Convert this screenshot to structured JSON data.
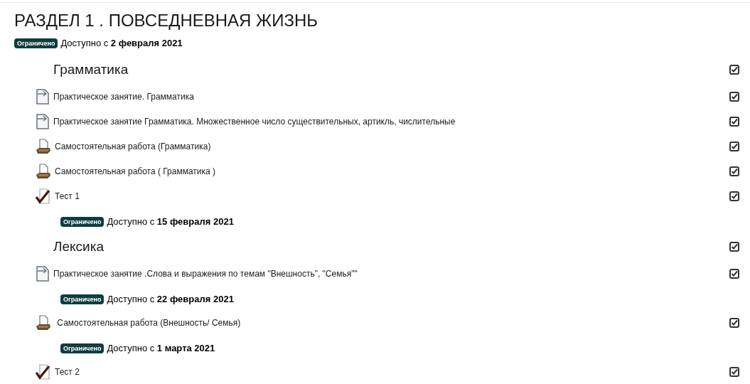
{
  "section": {
    "title": "РАЗДЕЛ 1 . ПОВСЕДНЕВНАЯ ЖИЗНЬ",
    "restriction": {
      "badge": "Ограничено",
      "text": "Доступно с **2 февраля 2021**"
    }
  },
  "items": [
    {
      "kind": "heading",
      "label": "Грамматика",
      "checked": true
    },
    {
      "kind": "page",
      "label": "Практическое занятие. Грамматика",
      "checked": true
    },
    {
      "kind": "page",
      "label": "Практическое занятие Грамматика. Множественное число существительных, артикль, числительные",
      "checked": true
    },
    {
      "kind": "assignment",
      "label": "Самостоятельная работа (Грамматика)",
      "checked": true
    },
    {
      "kind": "assignment",
      "label": "Самостоятельная работа ( Грамматика )",
      "checked": true
    },
    {
      "kind": "quiz",
      "label": "Тест 1",
      "checked": true
    },
    {
      "kind": "restriction",
      "badge": "Ограничено",
      "text": "Доступно с **15 февраля 2021**"
    },
    {
      "kind": "heading",
      "label": "Лексика",
      "checked": true
    },
    {
      "kind": "page",
      "label": "Практическое занятие .Слова и выражения по темам \"Внешность\", \"Семья\"\"",
      "checked": true
    },
    {
      "kind": "restriction",
      "badge": "Ограничено",
      "text": "Доступно с **22 февраля 2021**"
    },
    {
      "kind": "assignment",
      "label": " Самостоятельная работа (Внешность/ Семья)",
      "checked": true
    },
    {
      "kind": "restriction",
      "badge": "Ограничено",
      "text": "Доступно с **1 марта 2021**"
    },
    {
      "kind": "quiz",
      "label": "Тест 2",
      "checked": true
    }
  ]
}
